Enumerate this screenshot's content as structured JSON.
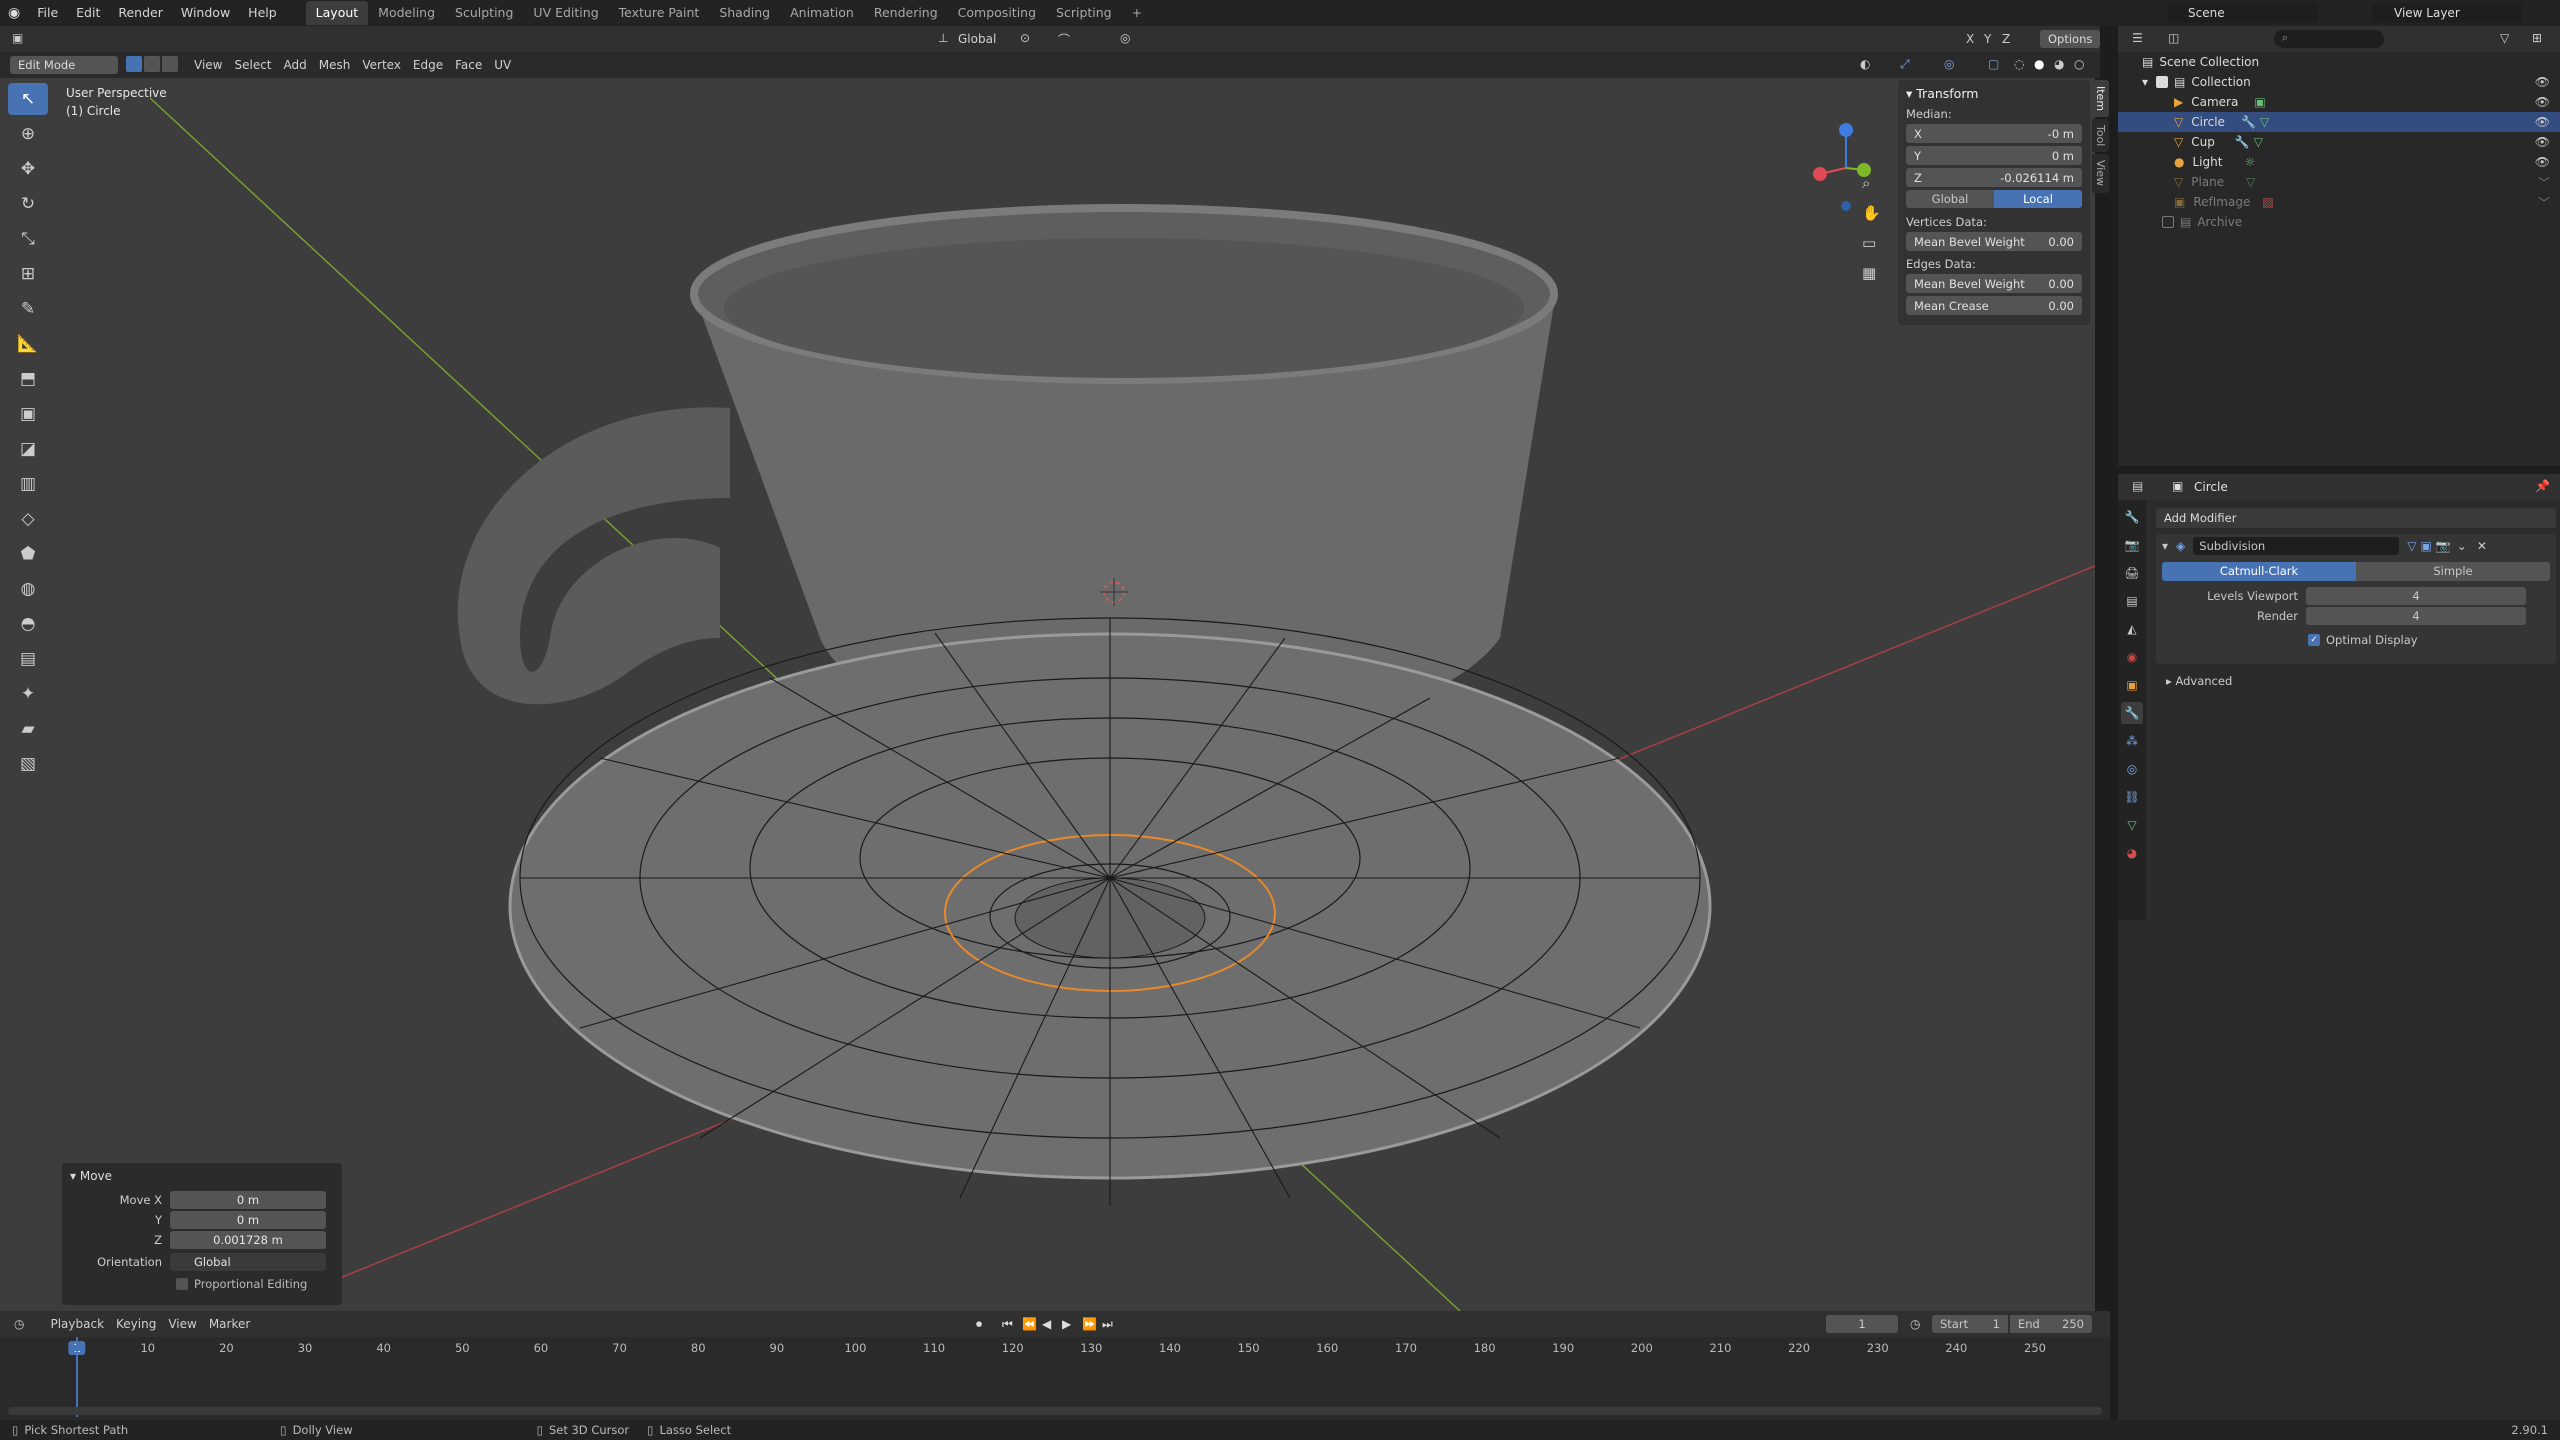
{
  "menus": [
    "File",
    "Edit",
    "Render",
    "Window",
    "Help"
  ],
  "workspaces": [
    "Layout",
    "Modeling",
    "Sculpting",
    "UV Editing",
    "Texture Paint",
    "Shading",
    "Animation",
    "Rendering",
    "Compositing",
    "Scripting",
    "+"
  ],
  "active_workspace": "Layout",
  "scene": "Scene",
  "view_layer": "View Layer",
  "header2": {
    "orientation": "Global",
    "axes": [
      "X",
      "Y",
      "Z"
    ],
    "options": "Options"
  },
  "header3": {
    "mode": "Edit Mode",
    "menus": [
      "View",
      "Select",
      "Add",
      "Mesh",
      "Vertex",
      "Edge",
      "Face",
      "UV"
    ]
  },
  "viewport": {
    "perspective": "User Perspective",
    "object": "(1) Circle"
  },
  "npanel": {
    "title": "Transform",
    "median_label": "Median:",
    "x_label": "X",
    "x": "-0 m",
    "y_label": "Y",
    "y": "0 m",
    "z_label": "Z",
    "z": "-0.026114 m",
    "global": "Global",
    "local": "Local",
    "vertices_data": "Vertices Data:",
    "mean_bevel_weight": "Mean Bevel Weight",
    "v_bevel": "0.00",
    "edges_data": "Edges Data:",
    "e_bevel": "0.00",
    "mean_crease": "Mean Crease",
    "e_crease": "0.00",
    "tabs": [
      "Item",
      "Tool",
      "View"
    ]
  },
  "outliner": {
    "root": "Scene Collection",
    "collection": "Collection",
    "items": [
      {
        "name": "Camera",
        "state": "normal"
      },
      {
        "name": "Circle",
        "state": "selected"
      },
      {
        "name": "Cup",
        "state": "normal"
      },
      {
        "name": "Light",
        "state": "normal"
      },
      {
        "name": "Plane",
        "state": "dim"
      },
      {
        "name": "RefImage",
        "state": "dim"
      }
    ],
    "archive": "Archive"
  },
  "properties": {
    "object": "Circle",
    "add_modifier": "Add Modifier",
    "modifier": "Subdivision",
    "catmull": "Catmull-Clark",
    "simple": "Simple",
    "levels_viewport_label": "Levels Viewport",
    "levels_viewport": "4",
    "render_label": "Render",
    "render": "4",
    "optimal_display": "Optimal Display",
    "advanced": "Advanced"
  },
  "move_panel": {
    "title": "Move",
    "move_x_label": "Move X",
    "move_x": "0 m",
    "y_label": "Y",
    "y": "0 m",
    "z_label": "Z",
    "z": "0.001728 m",
    "orientation_label": "Orientation",
    "orientation": "Global",
    "proportional": "Proportional Editing"
  },
  "timeline": {
    "menus": [
      "Playback",
      "Keying",
      "View",
      "Marker"
    ],
    "current_frame": "1",
    "start_label": "Start",
    "start": "1",
    "end_label": "End",
    "end": "250",
    "ticks": [
      "1",
      "10",
      "20",
      "30",
      "40",
      "50",
      "60",
      "70",
      "80",
      "90",
      "100",
      "110",
      "120",
      "130",
      "140",
      "150",
      "160",
      "170",
      "180",
      "190",
      "200",
      "210",
      "220",
      "230",
      "240",
      "250"
    ]
  },
  "status": {
    "left": "Pick Shortest Path",
    "mid": "Dolly View",
    "cursor": "Set 3D Cursor",
    "lasso": "Lasso Select",
    "version": "2.90.1"
  },
  "colors": {
    "accent": "#4772b3",
    "selected_edge": "#e8892a",
    "x_axis": "#c8424a",
    "y_axis": "#8bbf2a"
  }
}
